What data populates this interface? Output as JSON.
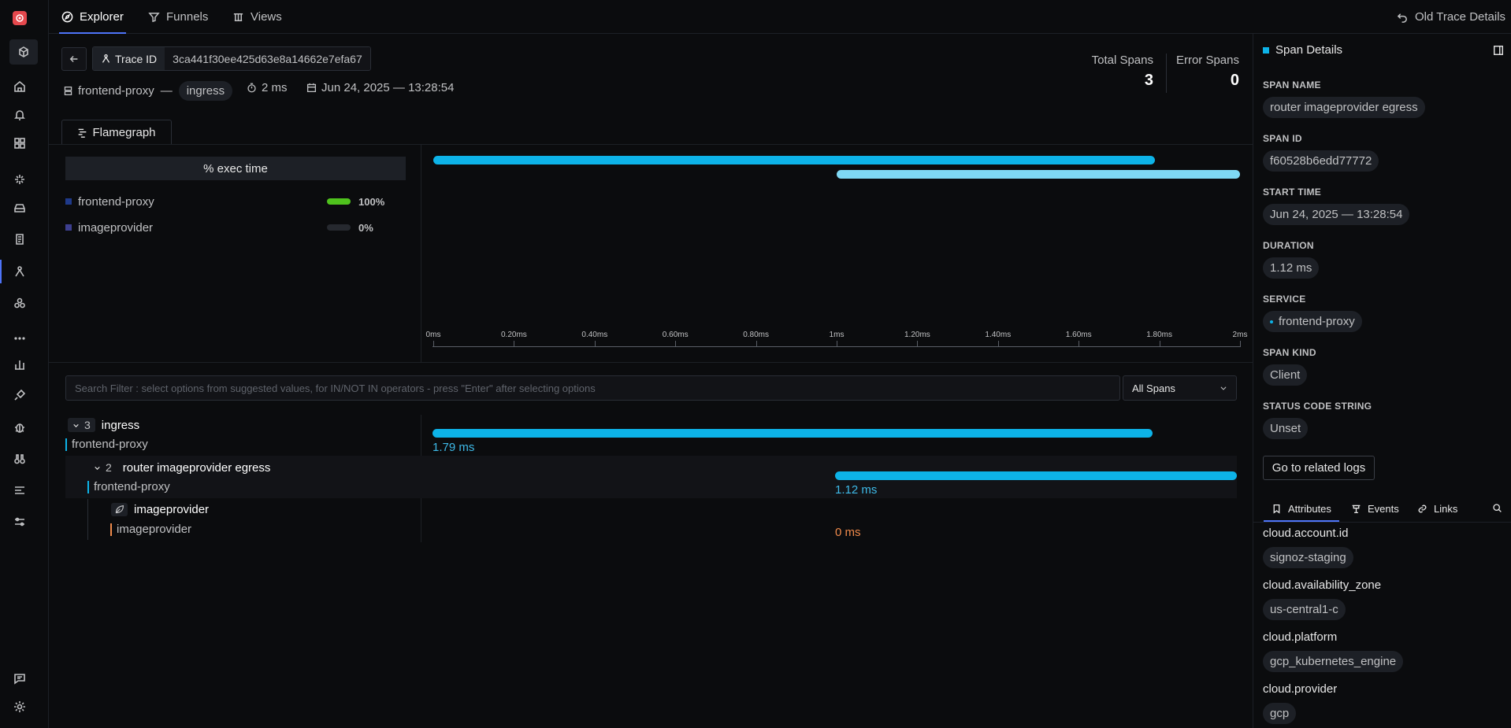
{
  "nav": {
    "tabs": [
      {
        "label": "Explorer",
        "icon": "compass-icon"
      },
      {
        "label": "Funnels",
        "icon": "funnel-icon"
      },
      {
        "label": "Views",
        "icon": "views-icon"
      }
    ],
    "old_trace_label": "Old Trace Details"
  },
  "trace": {
    "id_label": "Trace ID",
    "id_value": "3ca441f30ee425d63e8a14662e7efa67",
    "service": "frontend-proxy",
    "separator": "—",
    "operation": "ingress",
    "duration": "2 ms",
    "date": "Jun 24, 2025 — 13:28:54",
    "total_spans_label": "Total Spans",
    "total_spans": "3",
    "error_spans_label": "Error Spans",
    "error_spans": "0"
  },
  "flamegraph": {
    "tab_label": "Flamegraph",
    "exec_time_header": "% exec time",
    "services": [
      {
        "name": "frontend-proxy",
        "pct": "100%",
        "fill": 1.0,
        "color": "#1f3a8a",
        "bar_color": "#4fc21d"
      },
      {
        "name": "imageprovider",
        "pct": "0%",
        "fill": 0.0,
        "color": "#3d3f8f",
        "bar_color": "#26292f"
      }
    ],
    "axis_ticks": [
      "0ms",
      "0.20ms",
      "0.40ms",
      "0.60ms",
      "0.80ms",
      "1ms",
      "1.20ms",
      "1.40ms",
      "1.60ms",
      "1.80ms",
      "2ms"
    ],
    "axis_max_ms": 2.0,
    "bars": [
      {
        "start_ms": 0,
        "end_ms": 1.79,
        "color": "#0db3e8"
      },
      {
        "start_ms": 1.0,
        "end_ms": 2.0,
        "color": "#7fd9f4"
      }
    ]
  },
  "filter": {
    "placeholder": "Search Filter : select options from suggested values, for IN/NOT IN operators - press \"Enter\" after selecting options",
    "select_value": "All Spans"
  },
  "waterfall": {
    "rows": [
      {
        "count": "3",
        "name": "ingress",
        "service": "frontend-proxy",
        "duration": "1.79 ms",
        "start_ms": 0,
        "end_ms": 1.79,
        "svc_color": "#0db3e8"
      },
      {
        "count": "2",
        "name": "router imageprovider egress",
        "service": "frontend-proxy",
        "duration": "1.12 ms",
        "start_ms": 1.0,
        "end_ms": 2.0,
        "svc_color": "#0db3e8"
      },
      {
        "name": "imageprovider",
        "service": "imageprovider",
        "duration": "0 ms",
        "svc_color": "#f08a4b"
      }
    ]
  },
  "span_details": {
    "title": "Span Details",
    "fields": [
      {
        "key": "SPAN NAME",
        "value": "router imageprovider egress"
      },
      {
        "key": "SPAN ID",
        "value": "f60528b6edd77772"
      },
      {
        "key": "START TIME",
        "value": "Jun 24, 2025 — 13:28:54"
      },
      {
        "key": "DURATION",
        "value": "1.12 ms"
      },
      {
        "key": "SERVICE",
        "value": "frontend-proxy"
      },
      {
        "key": "SPAN KIND",
        "value": "Client"
      },
      {
        "key": "STATUS CODE STRING",
        "value": "Unset"
      }
    ],
    "logs_button": "Go to related logs",
    "tabs": [
      "Attributes",
      "Events",
      "Links"
    ],
    "attributes": [
      {
        "key": "cloud.account.id",
        "value": "signoz-staging"
      },
      {
        "key": "cloud.availability_zone",
        "value": "us-central1-c"
      },
      {
        "key": "cloud.platform",
        "value": "gcp_kubernetes_engine"
      },
      {
        "key": "cloud.provider",
        "value": "gcp"
      }
    ]
  },
  "colors": {
    "accent": "#4e74f8",
    "span_bar": "#0db3e8",
    "logo": "#e5484d"
  }
}
